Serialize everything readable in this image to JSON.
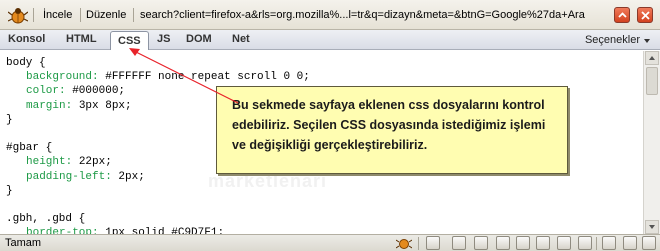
{
  "toolbar": {
    "inspect_label": "İncele",
    "edit_label": "Düzenle",
    "url": "search?client=firefox-a&rls=org.mozilla%...l=tr&q=dizayn&meta=&btnG=Google%27da+Ara"
  },
  "tabs": [
    "Konsol",
    "HTML",
    "CSS",
    "JS",
    "DOM",
    "Net"
  ],
  "active_tab": "CSS",
  "options_label": "Seçenekler",
  "code_lines": [
    {
      "indent": 0,
      "sel": "body {",
      "prop": "",
      "val": ""
    },
    {
      "indent": 1,
      "sel": "",
      "prop": "background:",
      "val": " #FFFFFF none repeat scroll 0 0;"
    },
    {
      "indent": 1,
      "sel": "",
      "prop": "color:",
      "val": " #000000;"
    },
    {
      "indent": 1,
      "sel": "",
      "prop": "margin:",
      "val": " 3px 8px;"
    },
    {
      "indent": 0,
      "sel": "}",
      "prop": "",
      "val": ""
    },
    {
      "indent": 0,
      "sel": "",
      "prop": "",
      "val": ""
    },
    {
      "indent": 0,
      "sel": "#gbar {",
      "prop": "",
      "val": ""
    },
    {
      "indent": 1,
      "sel": "",
      "prop": "height:",
      "val": " 22px;"
    },
    {
      "indent": 1,
      "sel": "",
      "prop": "padding-left:",
      "val": " 2px;"
    },
    {
      "indent": 0,
      "sel": "}",
      "prop": "",
      "val": ""
    },
    {
      "indent": 0,
      "sel": "",
      "prop": "",
      "val": ""
    },
    {
      "indent": 0,
      "sel": ".gbh, .gbd {",
      "prop": "",
      "val": ""
    },
    {
      "indent": 1,
      "sel": "",
      "prop": "border-top:",
      "val": " 1px solid #C9D7F1;"
    }
  ],
  "callout_text": "Bu sekmede sayfaya eklenen css dosyalarını kontrol edebiliriz. Seçilen CSS dosyasında istediğimiz işlemi ve değişikliği gerçekleştirebiliriz.",
  "watermark": "marketlenari",
  "status": {
    "label": "Tamam"
  },
  "colors": {
    "property": "#1d9a46",
    "callout_bg": "#fffdb1",
    "arrow": "#e8232a"
  }
}
